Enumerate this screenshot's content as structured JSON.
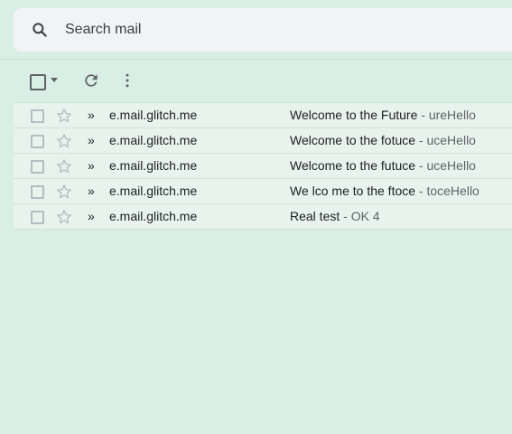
{
  "search": {
    "placeholder": "Search mail",
    "icon": "search-icon"
  },
  "toolbar": {
    "select_icon": "checkbox-icon",
    "select_menu_icon": "caret-down-icon",
    "refresh_icon": "refresh-icon",
    "more_icon": "more-vert-icon"
  },
  "emails": [
    {
      "sender": "e.mail.glitch.me",
      "importance": "»",
      "subject": "Welcome to the Future",
      "snippet": " - ureHello"
    },
    {
      "sender": "e.mail.glitch.me",
      "importance": "»",
      "subject": "Welcome to the fotuce",
      "snippet": " - uceHello"
    },
    {
      "sender": "e.mail.glitch.me",
      "importance": "»",
      "subject": "Welcome to the futuce",
      "snippet": " - uceHello"
    },
    {
      "sender": "e.mail.glitch.me",
      "importance": "»",
      "subject": "We lco me to the ftoce",
      "snippet": " - toceHello"
    },
    {
      "sender": "e.mail.glitch.me",
      "importance": "»",
      "subject": "Real test",
      "snippet": " - OK 4"
    }
  ],
  "colors": {
    "background": "#d9eee4",
    "row_background": "#e8f3ee",
    "search_background": "#f1f3f4",
    "text_primary": "#202124",
    "text_secondary": "#5f6368"
  }
}
